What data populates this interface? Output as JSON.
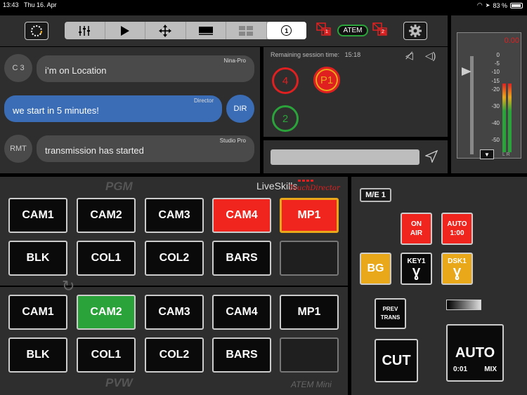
{
  "status": {
    "time": "13:43",
    "date": "Thu 16. Apr",
    "battery": "83 %"
  },
  "topbar": {
    "atem_label": "ATEM",
    "atem_left_index": "1",
    "atem_right_index": "2",
    "active_tab_label": "1"
  },
  "chat": {
    "messages": [
      {
        "avatar": "C 3",
        "sender": "Nina-Pro",
        "text": "i’m on Location"
      },
      {
        "avatar": "DIR",
        "sender": "Director",
        "text": "we start in 5 minutes!"
      },
      {
        "avatar": "RMT",
        "sender": "Studio Pro",
        "text": "transmission has started"
      }
    ]
  },
  "session": {
    "remaining_label": "Remaining session time:",
    "remaining_time": "15:18",
    "circles": [
      "4",
      "P1",
      "2"
    ]
  },
  "audio": {
    "level": "0.00",
    "scale": [
      "0",
      "-5",
      "-10",
      "-15",
      "-20",
      "-30",
      "-40",
      "-50"
    ],
    "channels": "L R"
  },
  "switcher": {
    "pgm_label": "PGM",
    "pvw_label": "PVW",
    "brand": "LiveSkills",
    "brand_script": "TouchDirector",
    "device": "ATEM Mini",
    "pgm_row1": [
      "CAM1",
      "CAM2",
      "CAM3",
      "CAM4",
      "MP1"
    ],
    "pgm_row2": [
      "BLK",
      "COL1",
      "COL2",
      "BARS",
      ""
    ],
    "pvw_row1": [
      "CAM1",
      "CAM2",
      "CAM3",
      "CAM4",
      "MP1"
    ],
    "pvw_row2": [
      "BLK",
      "COL1",
      "COL2",
      "BARS",
      ""
    ]
  },
  "me": {
    "me_label": "M/E 1",
    "on_air_1": "ON",
    "on_air_2": "AIR",
    "auto_1": "AUTO",
    "auto_2": "1:00",
    "bg": "BG",
    "key1": "KEY1",
    "dsk1": "DSK1",
    "prev_1": "PREV",
    "prev_2": "TRANS",
    "cut": "CUT",
    "auto_big": "AUTO",
    "auto_time": "0:01",
    "auto_mix": "MIX"
  }
}
